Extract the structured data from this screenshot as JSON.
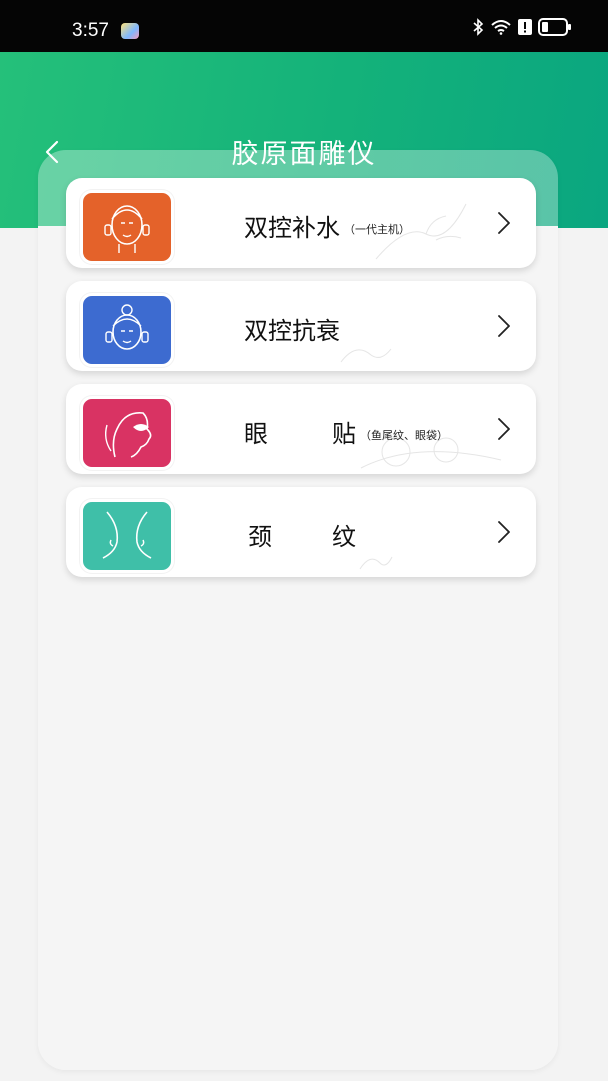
{
  "status_bar": {
    "time": "3:57"
  },
  "header": {
    "title": "胶原面雕仪",
    "back_icon": "chevron-left-icon"
  },
  "menu": {
    "items": [
      {
        "label": "双控补水",
        "sub": "（一代主机）",
        "icon": "face-hydration-icon",
        "color": "#e4622a"
      },
      {
        "label": "双控抗衰",
        "sub": "",
        "icon": "face-antiaging-icon",
        "color": "#3d6bd0"
      },
      {
        "label_a": "眼",
        "label_b": "贴",
        "sub": "（鱼尾纹、眼袋）",
        "icon": "eye-patch-icon",
        "color": "#d93363"
      },
      {
        "label_a": "颈",
        "label_b": "纹",
        "sub": "",
        "icon": "neck-lines-icon",
        "color": "#3fbfa8"
      }
    ]
  }
}
